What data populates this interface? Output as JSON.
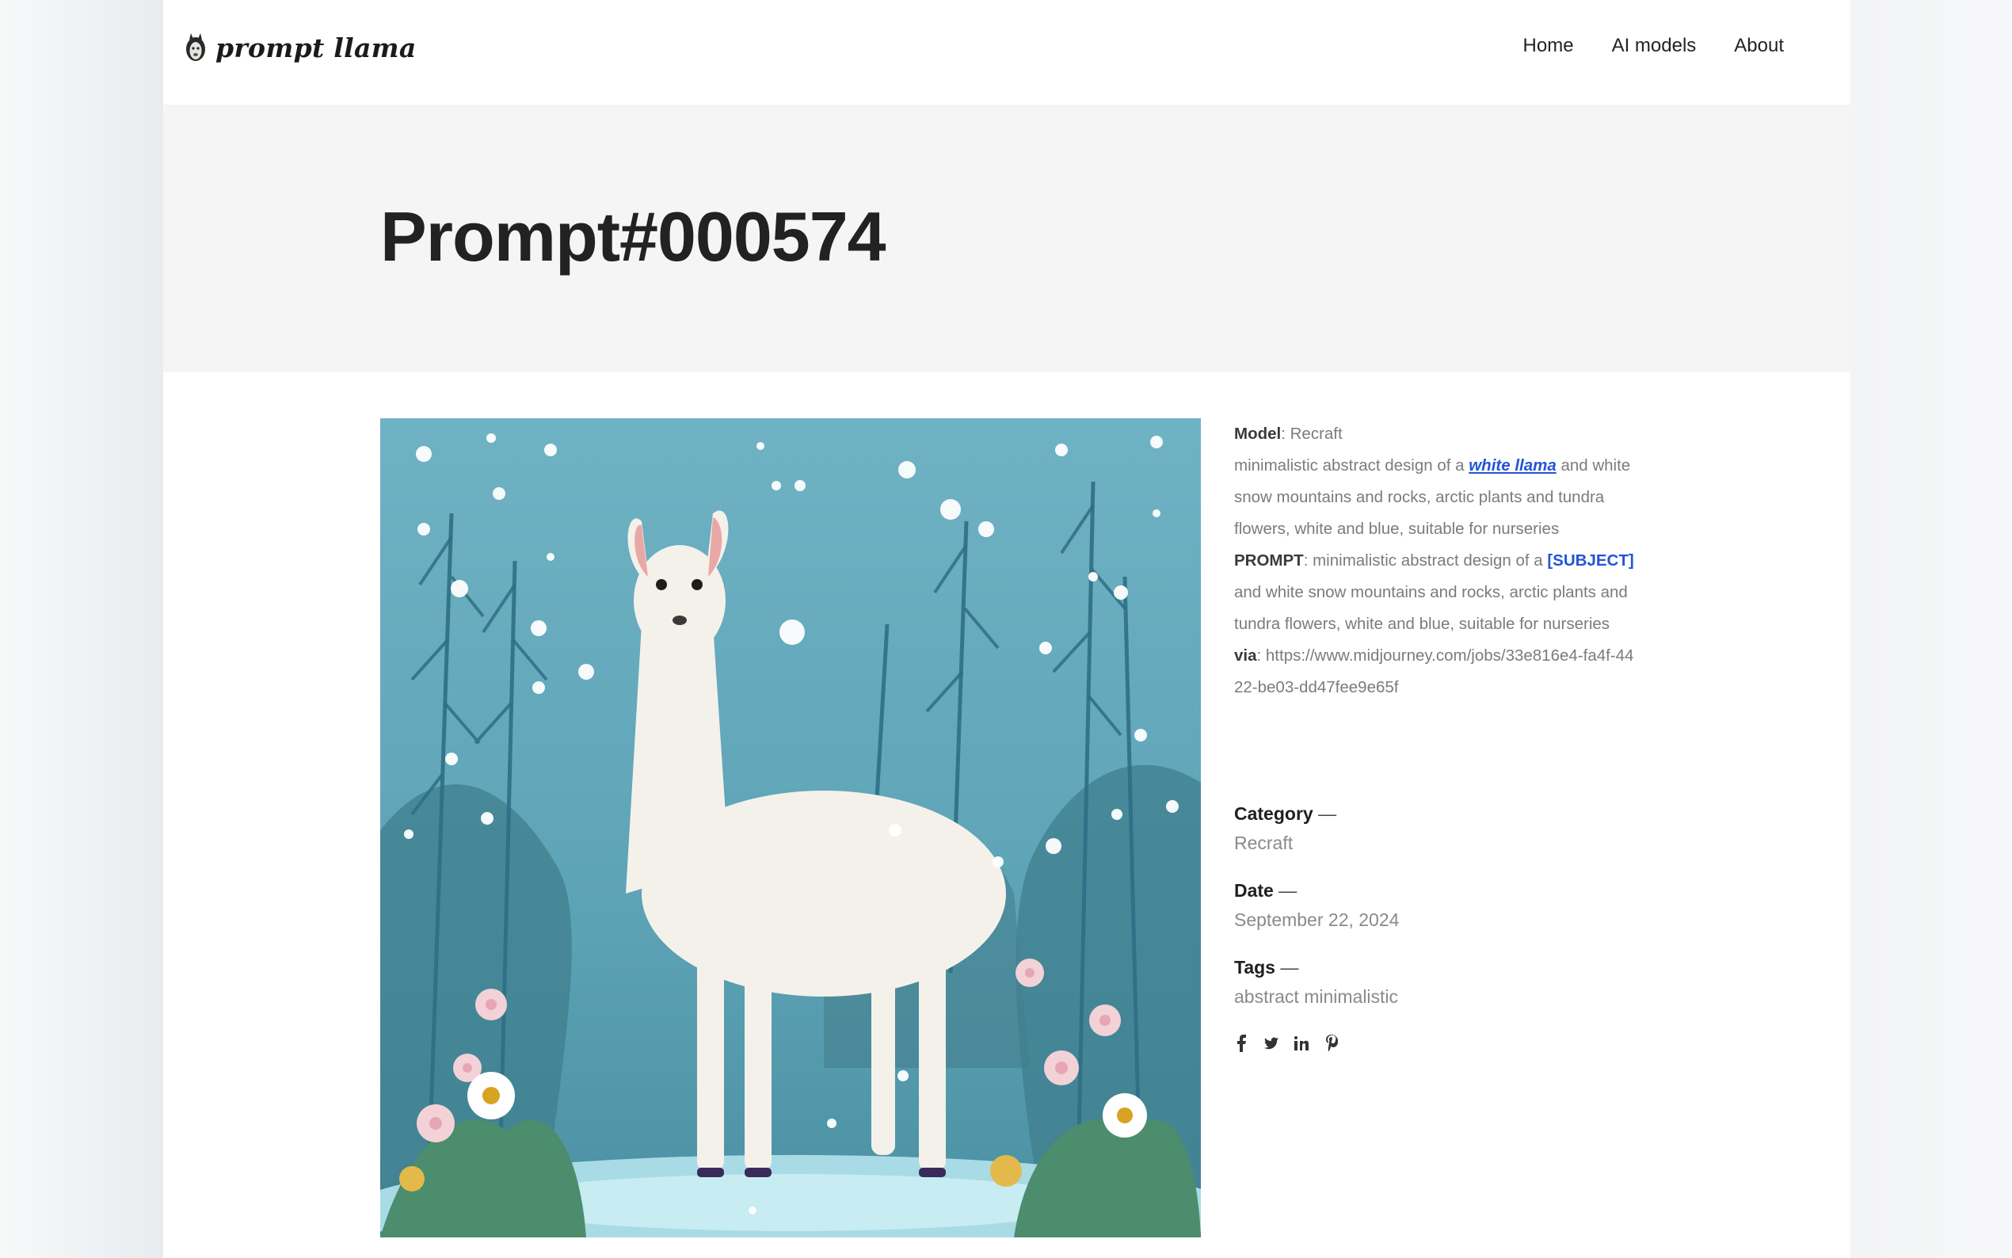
{
  "site": {
    "logo_text": "prompt llama",
    "nav": [
      "Home",
      "AI models",
      "About"
    ]
  },
  "page": {
    "title": "Prompt#000574"
  },
  "details": {
    "model_label": "Model",
    "model_value": "Recraft",
    "description_prefix": "minimalistic abstract design of a ",
    "description_subject": "white llama",
    "description_suffix": " and white snow mountains and rocks, arctic plants and tundra flowers, white and blue, suitable for nurseries",
    "prompt_label": "PROMPT",
    "prompt_prefix": "minimalistic abstract design of a ",
    "prompt_subject": "[SUBJECT]",
    "prompt_suffix": " and white snow mountains and rocks, arctic plants and tundra flowers, white and blue, suitable for nurseries",
    "via_label": "via",
    "via_value": "https://www.midjourney.com/jobs/33e816e4-fa4f-4422-be03-dd47fee9e65f"
  },
  "meta": {
    "category_label": "Category",
    "category_value": "Recraft",
    "date_label": "Date",
    "date_value": "September 22, 2024",
    "tags_label": "Tags",
    "tags_value": "abstract minimalistic",
    "dash": "—"
  },
  "social": [
    "facebook-icon",
    "twitter-icon",
    "linkedin-icon",
    "pinterest-icon"
  ]
}
